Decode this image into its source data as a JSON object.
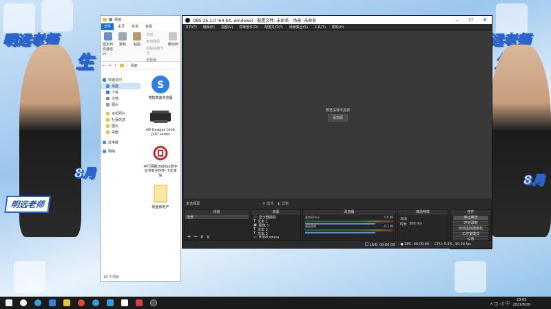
{
  "wallpaper": {
    "title_left": "明远老师",
    "title_left_partial": "生",
    "title_right": "明远老师",
    "title_right_partial": "生",
    "banner_left": "明远老师",
    "side_left": "8月",
    "side_right": "8月"
  },
  "explorer": {
    "titlebar_text": "桌面",
    "tabs": [
      "文件",
      "主页",
      "共享",
      "查看"
    ],
    "ribbon": {
      "pin": "固定到快速访问",
      "copy": "复制",
      "paste": "粘贴",
      "cut": "剪切",
      "copy_path": "复制路径",
      "paste_shortcut": "粘贴快捷方式",
      "clipboard": "剪贴板",
      "move_to": "移动到"
    },
    "address": "桌面",
    "nav": [
      {
        "label": "快速访问",
        "color": "#2e7fd8"
      },
      {
        "label": "桌面",
        "color": "#3d8fe0"
      },
      {
        "label": "下载",
        "color": "#2e7fd8"
      },
      {
        "label": "文档",
        "color": "#888"
      },
      {
        "label": "图片",
        "color": "#6aa0d8"
      },
      {
        "label": "本机照片",
        "color": "#e8c24a"
      },
      {
        "label": "社保信息",
        "color": "#e8c24a"
      },
      {
        "label": "图片",
        "color": "#e8c24a"
      },
      {
        "label": "桌面",
        "color": "#e8c24a"
      },
      {
        "label": "此电脑",
        "color": "#4a90d9"
      },
      {
        "label": "网络",
        "color": "#4a90d9"
      }
    ],
    "files": [
      {
        "name": "搜狗高速浏览器",
        "icon": "sogou-browser-icon"
      },
      {
        "name": "HP DeskJet 1000 J110 series",
        "icon": "printer-icon"
      },
      {
        "name": "中行网银USBKey数字证书安全控件-飞天诚信",
        "icon": "boc-icon"
      },
      {
        "name": "网盘房地产",
        "icon": "folder-icon"
      }
    ],
    "status": "16 个项目"
  },
  "obs": {
    "title": "OBS 26.1.0 (64-bit, windows) - 配置文件: 未命名 - 场景: 未命名",
    "menu": [
      "文件(F)",
      "编辑(E)",
      "视图(V)",
      "停靠部件(D)",
      "配置文件(P)",
      "场景集合(S)",
      "工具(T)",
      "帮助(H)"
    ],
    "preview_text": "预览没有可见源",
    "add_source": "添加源",
    "no_selection": "未选择源",
    "props_btn": "属性",
    "filters_btn": "滤镜",
    "docks": {
      "scenes": {
        "title": "场景",
        "items": [
          "场景"
        ]
      },
      "sources": {
        "title": "来源",
        "items": [
          "显示器捕获",
          "文本 1",
          "图像 1",
          "文本 2",
          "文本 3",
          "HDMI sousa"
        ]
      },
      "mixer": {
        "title": "混音器",
        "channels": [
          {
            "name": "麦克风/Aux",
            "db": "0.0 dB"
          },
          {
            "name": "桌面音频",
            "db": "-0.1 dB"
          }
        ]
      },
      "transitions": {
        "title": "转场特效",
        "type": "淡出",
        "duration_label": "时长",
        "duration": "300 ms"
      },
      "controls": {
        "title": "控件",
        "buttons": [
          "停止推流",
          "开始录制",
          "启动虚拟摄像机",
          "工作室模式",
          "设置",
          "退出"
        ]
      }
    },
    "status": {
      "live": "LIVE: 00:00:00",
      "rec": "REC: 00:00:00",
      "cpu": "CPU: 5.4%, 30.00 fps"
    }
  },
  "taskbar": {
    "icons": [
      {
        "name": "start-icon",
        "color": "#f2f2f2"
      },
      {
        "name": "search-icon",
        "color": "#f2f2f2"
      },
      {
        "name": "edge-icon",
        "color": "#2fa3e0"
      },
      {
        "name": "ie-icon",
        "color": "#3d7fd6"
      },
      {
        "name": "explorer-icon",
        "color": "#e8c24a"
      },
      {
        "name": "chrome-icon",
        "color": "#e04a3a"
      },
      {
        "name": "browser-icon",
        "color": "#3a9ad8"
      },
      {
        "name": "qq-icon",
        "color": "#3a9ad8"
      },
      {
        "name": "store-icon",
        "color": "#ffffff"
      },
      {
        "name": "media-icon",
        "color": "#d04040"
      },
      {
        "name": "obs-taskbar-icon",
        "color": "#555555"
      }
    ],
    "tray": "∧ ◫ ◁) 中",
    "time": "23:05",
    "date": "2021/8/20"
  }
}
